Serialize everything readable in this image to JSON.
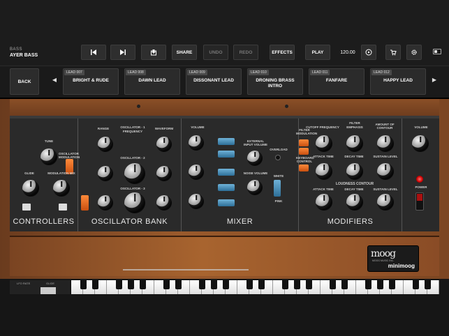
{
  "header": {
    "category": "BASS",
    "preset_name": "AYER BASS",
    "buttons": {
      "prev_icon": "play-reverse-icon",
      "next_icon": "play-forward-icon",
      "save_icon": "save-icon",
      "share": "SHARE",
      "undo": "UNDO",
      "redo": "REDO",
      "effects": "EFFECTS",
      "play": "PLAY",
      "bpm": "120.00",
      "sync_icon": "record-circle-icon",
      "store_icon": "cart-icon",
      "settings_icon": "gear-icon",
      "battery_icon": "battery-icon"
    }
  },
  "preset_strip": {
    "back": "BACK",
    "prev_arrow": "◀",
    "next_arrow": "▶",
    "slots": [
      {
        "tag": "LEAD 007",
        "name": "BRIGHT & RUDE"
      },
      {
        "tag": "LEAD 008",
        "name": "DAWN LEAD"
      },
      {
        "tag": "LEAD 009",
        "name": "DISSONANT LEAD"
      },
      {
        "tag": "LEAD 010",
        "name": "DRONING BRASS INTRO"
      },
      {
        "tag": "LEAD 011",
        "name": "FANFARE"
      },
      {
        "tag": "LEAD 012",
        "name": "HAPPY LEAD"
      }
    ]
  },
  "synth": {
    "controllers": {
      "title": "CONTROLLERS",
      "tune": "TUNE",
      "glide": "GLIDE",
      "mod_mix": "MODULATION MIX",
      "osc_mod": "OSCILLATOR MODULATION"
    },
    "oscillator_bank": {
      "title": "OSCILLATOR  BANK",
      "range": "RANGE",
      "frequency": "FREQUENCY",
      "waveform": "WAVEFORM",
      "osc1": "OSCILLATOR - 1",
      "osc2": "OSCILLATOR - 2",
      "osc3": "OSCILLATOR - 3"
    },
    "mixer": {
      "title": "MIXER",
      "volume": "VOLUME",
      "ext_input": "EXTERNAL INPUT VOLUME",
      "overload": "OVERLOAD",
      "noise_volume": "NOISE VOLUME",
      "white": "WHITE",
      "pink": "PINK"
    },
    "modifiers": {
      "title": "MODIFIERS",
      "filter": "FILTER",
      "cutoff": "CUTOFF FREQUENCY",
      "emphasis": "EMPHASIS",
      "amount": "AMOUNT OF CONTOUR",
      "filter_mod": "FILTER MODULATION",
      "keyboard_control": "KEYBOARD CONTROL",
      "attack": "ATTACK TIME",
      "decay": "DECAY TIME",
      "sustain": "SUSTAIN LEVEL",
      "loudness": "LOUDNESS CONTOUR"
    },
    "output": {
      "volume": "VOLUME",
      "power": "POWER"
    },
    "logo": {
      "brand": "moog",
      "sub": "MOOG MUSIC INC.",
      "model": "minimoog"
    },
    "left_controls": {
      "lfo_rate": "LFO RATE",
      "glide": "GLIDE"
    }
  }
}
